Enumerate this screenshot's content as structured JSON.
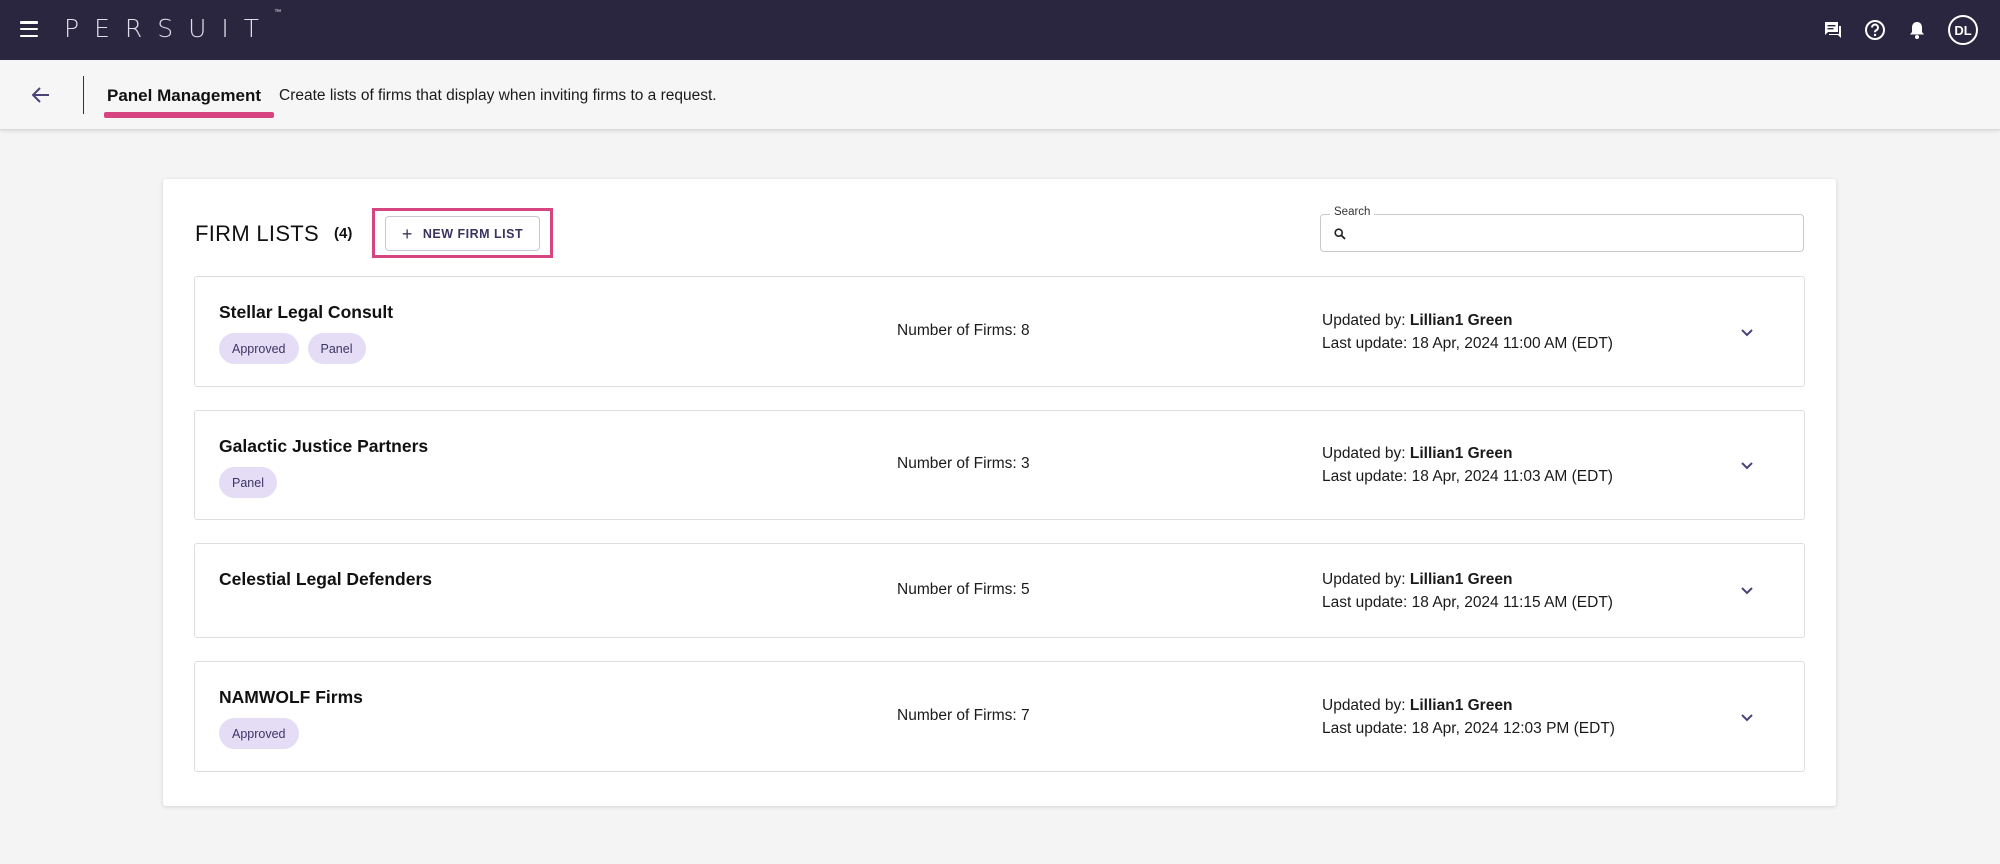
{
  "app": {
    "logo_text": "PERSUIT",
    "trademark": "™",
    "user_initials": "DL"
  },
  "topbar": {
    "icons": [
      "menu-icon",
      "chat-icon",
      "help-icon",
      "bell-icon"
    ]
  },
  "subheader": {
    "title": "Panel Management",
    "description": "Create lists of firms that display when inviting firms to a request."
  },
  "firm_lists": {
    "title": "FIRM LISTS",
    "count": "(4)",
    "new_button_label": "NEW FIRM LIST",
    "search": {
      "label": "Search",
      "value": "",
      "placeholder": ""
    },
    "rows": [
      {
        "name": "Stellar Legal Consult",
        "tags": [
          "Approved",
          "Panel"
        ],
        "firms": "Number of Firms: 8",
        "updated_by_label": "Updated by:",
        "updated_by": "Lillian1 Green",
        "last_update": "Last update: 18 Apr, 2024 11:00 AM (EDT)"
      },
      {
        "name": "Galactic Justice Partners",
        "tags": [
          "Panel"
        ],
        "firms": "Number of Firms: 3",
        "updated_by_label": "Updated by:",
        "updated_by": "Lillian1 Green",
        "last_update": "Last update: 18 Apr, 2024 11:03 AM (EDT)"
      },
      {
        "name": "Celestial Legal Defenders",
        "tags": [],
        "firms": "Number of Firms: 5",
        "updated_by_label": "Updated by:",
        "updated_by": "Lillian1 Green",
        "last_update": "Last update: 18 Apr, 2024 11:15 AM (EDT)"
      },
      {
        "name": "NAMWOLF Firms",
        "tags": [
          "Approved"
        ],
        "firms": "Number of Firms: 7",
        "updated_by_label": "Updated by:",
        "updated_by": "Lillian1 Green",
        "last_update": "Last update: 18 Apr, 2024 12:03 PM (EDT)"
      }
    ]
  },
  "colors": {
    "topbar": "#2b2640",
    "accent": "#d6457f",
    "tag_bg": "#e4ddf5",
    "tag_text": "#3d3566"
  }
}
